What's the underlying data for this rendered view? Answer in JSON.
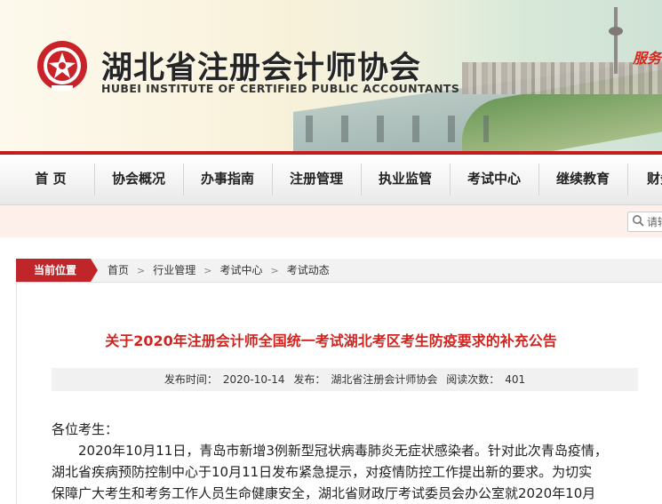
{
  "header": {
    "title": "湖北省注册会计师协会",
    "subtitle": "HUBEI INSTITUTE OF CERTIFIED PUBLIC ACCOUNTANTS",
    "slogan": "服务"
  },
  "nav": {
    "items": [
      "首 页",
      "协会概况",
      "办事指南",
      "注册管理",
      "执业监管",
      "考试中心",
      "继续教育",
      "财务"
    ]
  },
  "search": {
    "placeholder": "请输"
  },
  "breadcrumb": {
    "label": "当前位置",
    "items": [
      "首页",
      "行业管理",
      "考试中心",
      "考试动态"
    ]
  },
  "article": {
    "title": "关于2020年注册会计师全国统一考试湖北考区考生防疫要求的补充公告",
    "meta": {
      "date_label": "发布时间：",
      "date": "2020-10-14",
      "source_label": "发布：",
      "source": "湖北省注册会计师协会",
      "views_label": "阅读次数：",
      "views": "401"
    },
    "greeting": "各位考生：",
    "lines": [
      "2020年10月11日，青岛市新增3例新型冠状病毒肺炎无症状感染者。针对此次青岛疫情，",
      "湖北省疾病预防控制中心于10月11日发布紧急提示，对疫情防控工作提出新的要求。为切实",
      "保障广大考生和考务工作人员生命健康安全，湖北省财政厅考试委员会办公室就2020年10月"
    ]
  },
  "colors": {
    "accent": "#c41c1c",
    "title_red": "#d2231f"
  }
}
